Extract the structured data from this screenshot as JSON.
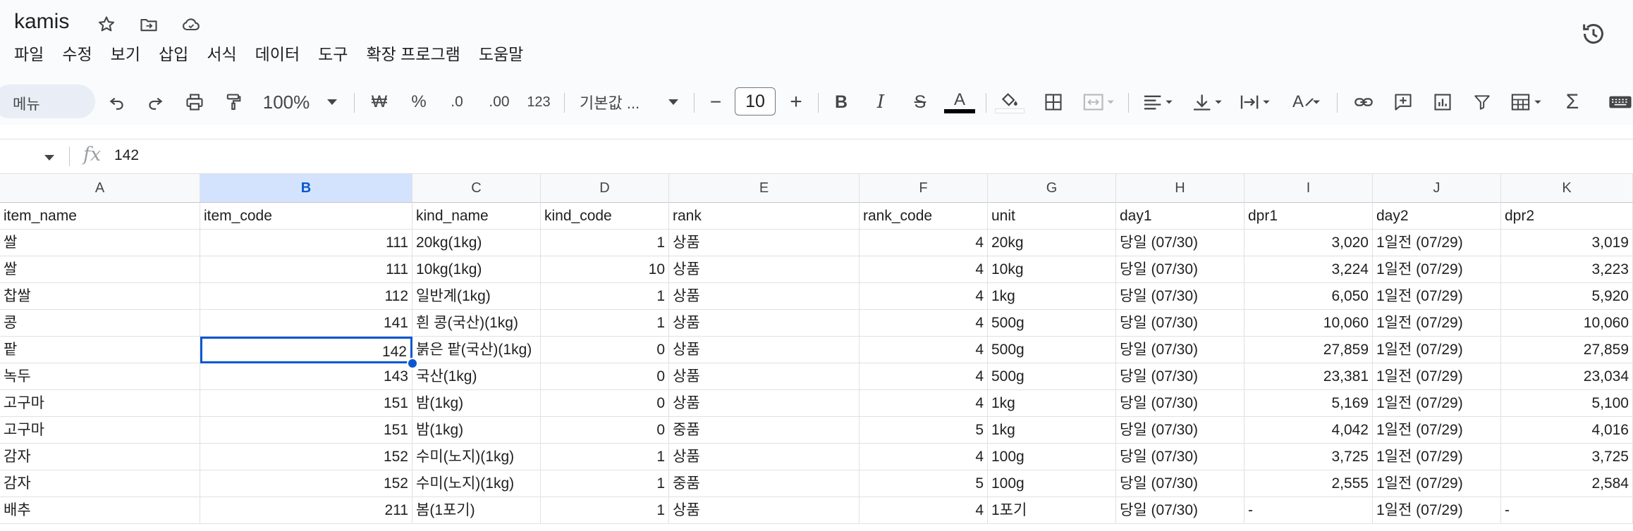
{
  "app": {
    "doc_title": "kamis",
    "menu": [
      "파일",
      "수정",
      "보기",
      "삽입",
      "서식",
      "데이터",
      "도구",
      "확장 프로그램",
      "도움말"
    ]
  },
  "toolbar": {
    "search_placeholder": "메뉴",
    "zoom": "100%",
    "currency": "₩",
    "percent": "%",
    "decrease_decimal": ".0",
    "increase_decimal": ".00",
    "number_format": "123",
    "font": "기본값 ...",
    "minus": "−",
    "font_size": "10",
    "plus": "+",
    "bold": "B",
    "italic": "I",
    "strike": "S",
    "text_color": "A",
    "text_rotation": "A"
  },
  "formula_bar": {
    "fx": "fx",
    "value": "142"
  },
  "sheet": {
    "columns": [
      "A",
      "B",
      "C",
      "D",
      "E",
      "F",
      "G",
      "H",
      "I",
      "J",
      "K"
    ],
    "selected_column": "B",
    "header": [
      "item_name",
      "item_code",
      "kind_name",
      "kind_code",
      "rank",
      "rank_code",
      "unit",
      "day1",
      "dpr1",
      "day2",
      "dpr2"
    ],
    "rows": [
      [
        "쌀",
        "111",
        "20kg(1kg)",
        "1",
        "상품",
        "4",
        "20kg",
        "당일 (07/30)",
        "3,020",
        "1일전 (07/29)",
        "3,019"
      ],
      [
        "쌀",
        "111",
        "10kg(1kg)",
        "10",
        "상품",
        "4",
        "10kg",
        "당일 (07/30)",
        "3,224",
        "1일전 (07/29)",
        "3,223"
      ],
      [
        "찹쌀",
        "112",
        "일반계(1kg)",
        "1",
        "상품",
        "4",
        "1kg",
        "당일 (07/30)",
        "6,050",
        "1일전 (07/29)",
        "5,920"
      ],
      [
        "콩",
        "141",
        "흰 콩(국산)(1kg)",
        "1",
        "상품",
        "4",
        "500g",
        "당일 (07/30)",
        "10,060",
        "1일전 (07/29)",
        "10,060"
      ],
      [
        "팥",
        "142",
        "붉은 팥(국산)(1kg)",
        "0",
        "상품",
        "4",
        "500g",
        "당일 (07/30)",
        "27,859",
        "1일전 (07/29)",
        "27,859"
      ],
      [
        "녹두",
        "143",
        "국산(1kg)",
        "0",
        "상품",
        "4",
        "500g",
        "당일 (07/30)",
        "23,381",
        "1일전 (07/29)",
        "23,034"
      ],
      [
        "고구마",
        "151",
        "밤(1kg)",
        "0",
        "상품",
        "4",
        "1kg",
        "당일 (07/30)",
        "5,169",
        "1일전 (07/29)",
        "5,100"
      ],
      [
        "고구마",
        "151",
        "밤(1kg)",
        "0",
        "중품",
        "5",
        "1kg",
        "당일 (07/30)",
        "4,042",
        "1일전 (07/29)",
        "4,016"
      ],
      [
        "감자",
        "152",
        "수미(노지)(1kg)",
        "1",
        "상품",
        "4",
        "100g",
        "당일 (07/30)",
        "3,725",
        "1일전 (07/29)",
        "3,725"
      ],
      [
        "감자",
        "152",
        "수미(노지)(1kg)",
        "1",
        "중품",
        "5",
        "100g",
        "당일 (07/30)",
        "2,555",
        "1일전 (07/29)",
        "2,584"
      ],
      [
        "배추",
        "211",
        "봄(1포기)",
        "1",
        "상품",
        "4",
        "1포기",
        "당일 (07/30)",
        "-",
        "1일전 (07/29)",
        "-"
      ]
    ]
  },
  "colors": {
    "accent": "#0b57d0",
    "selected_header_bg": "#d3e3fd",
    "toolbar_bg": "#f9fbfd"
  }
}
